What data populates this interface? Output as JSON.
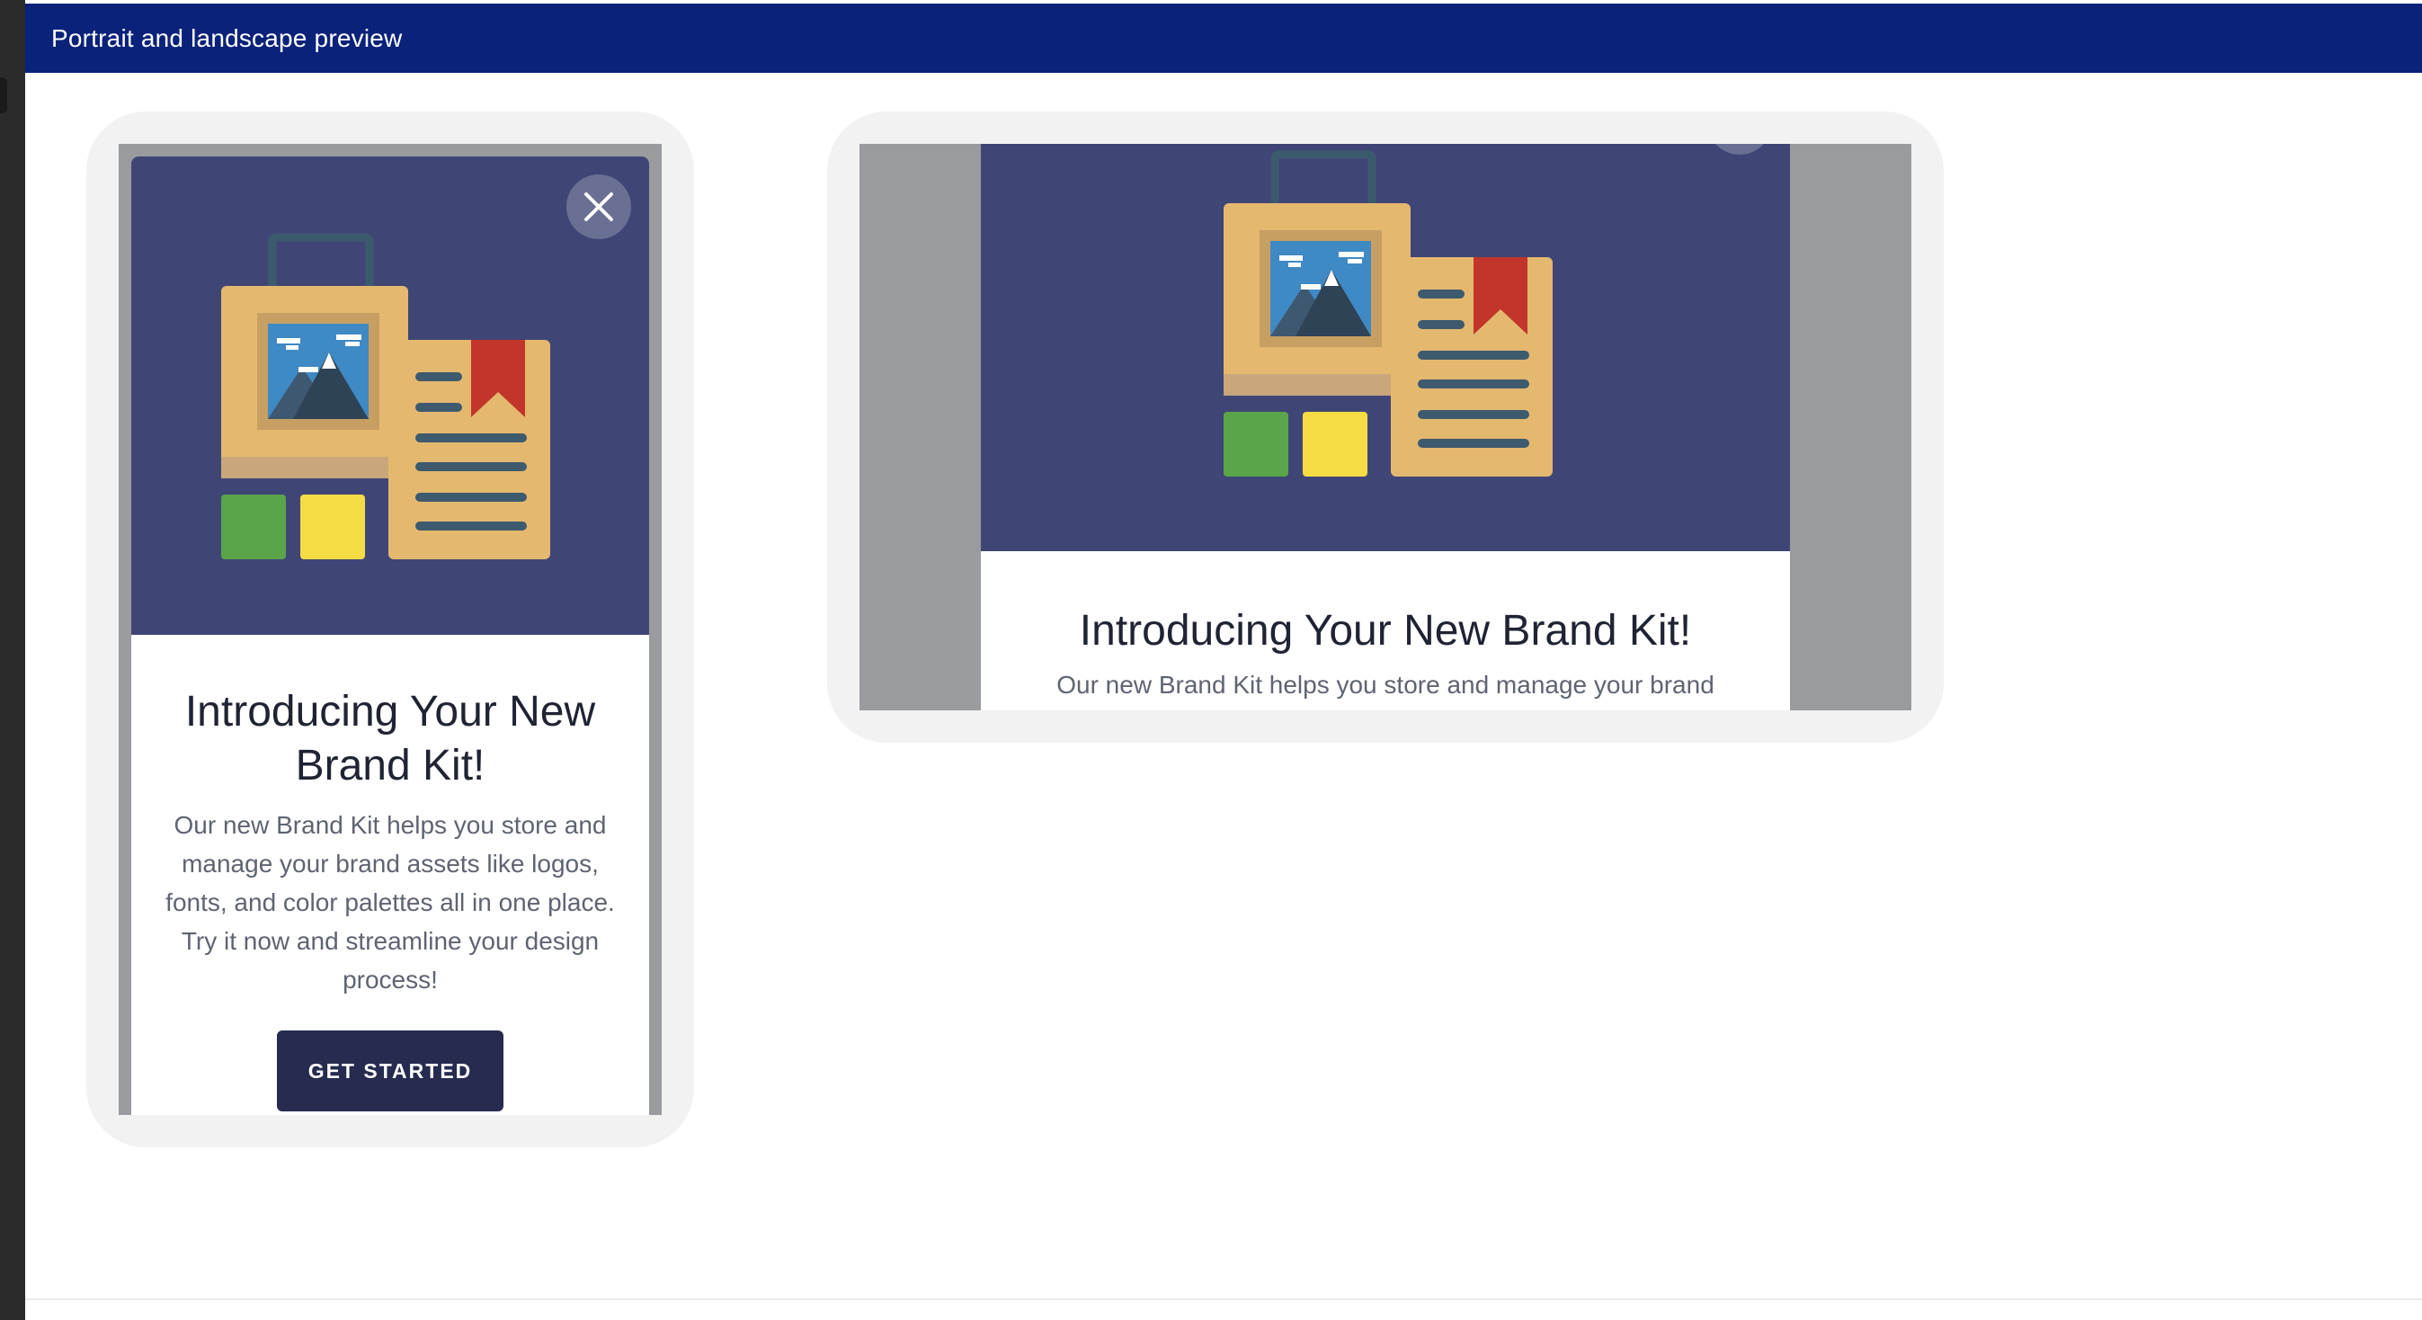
{
  "header": {
    "title": "Portrait and landscape preview"
  },
  "colors": {
    "header_bg": "#0a227a",
    "hero_bg": "#3f4676",
    "cta_bg": "#262b4f",
    "screen_bg": "#999b9e",
    "frame_bg": "#f2f2f2"
  },
  "portrait": {
    "close_icon": "close-icon",
    "illustration": "brand-kit-illustration",
    "title": "Introducing Your New Brand Kit!",
    "body": "Our new Brand Kit helps you store and manage your brand assets like logos, fonts, and color palettes all in one place. Try it now and streamline your design process!",
    "cta_label": "GET STARTED"
  },
  "landscape": {
    "illustration": "brand-kit-illustration",
    "title": "Introducing Your New Brand Kit!",
    "body": "Our new Brand Kit helps you store and manage your brand"
  }
}
